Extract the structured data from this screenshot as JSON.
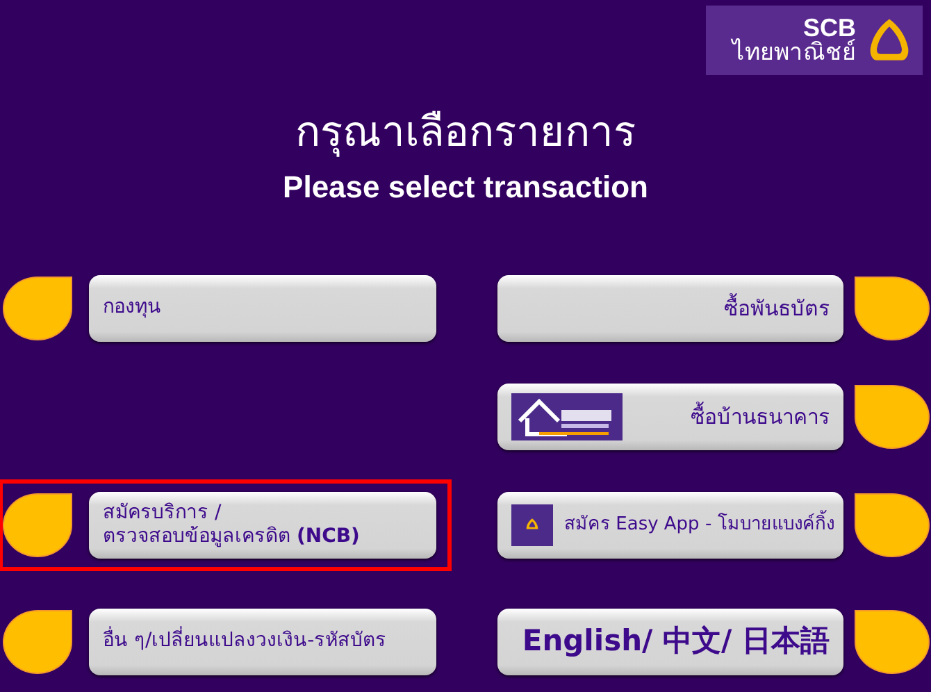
{
  "logo": {
    "name": "SCB",
    "subtitle": "ไทยพาณิชย์"
  },
  "title": "กรุณาเลือกรายการ",
  "subtitle": "Please select transaction",
  "rows": [
    {
      "left": {
        "label": "กองทุน",
        "selected": false
      },
      "right": {
        "label": "ซื้อพันธบัตร",
        "kind": "plain",
        "selected": false
      }
    },
    {
      "right": {
        "label": "ซื้อบ้านธนาคาร",
        "kind": "picture",
        "selected": false
      }
    },
    {
      "left": {
        "label": "สมัครบริการ /\nตรวจสอบข้อมูลเครดิต **(NCB)**",
        "selected": true
      },
      "right": {
        "label": "สมัคร Easy App - โมบายแบงค์กิ้ง",
        "kind": "app-icon",
        "selected": false
      }
    },
    {
      "left": {
        "label": "อื่น ๆ/เปลี่ยนแปลงวงเงิน-รหัสบัตร",
        "selected": false
      },
      "right": {
        "label": "English/ 中文/ 日本語",
        "kind": "large",
        "selected": false
      }
    }
  ]
}
